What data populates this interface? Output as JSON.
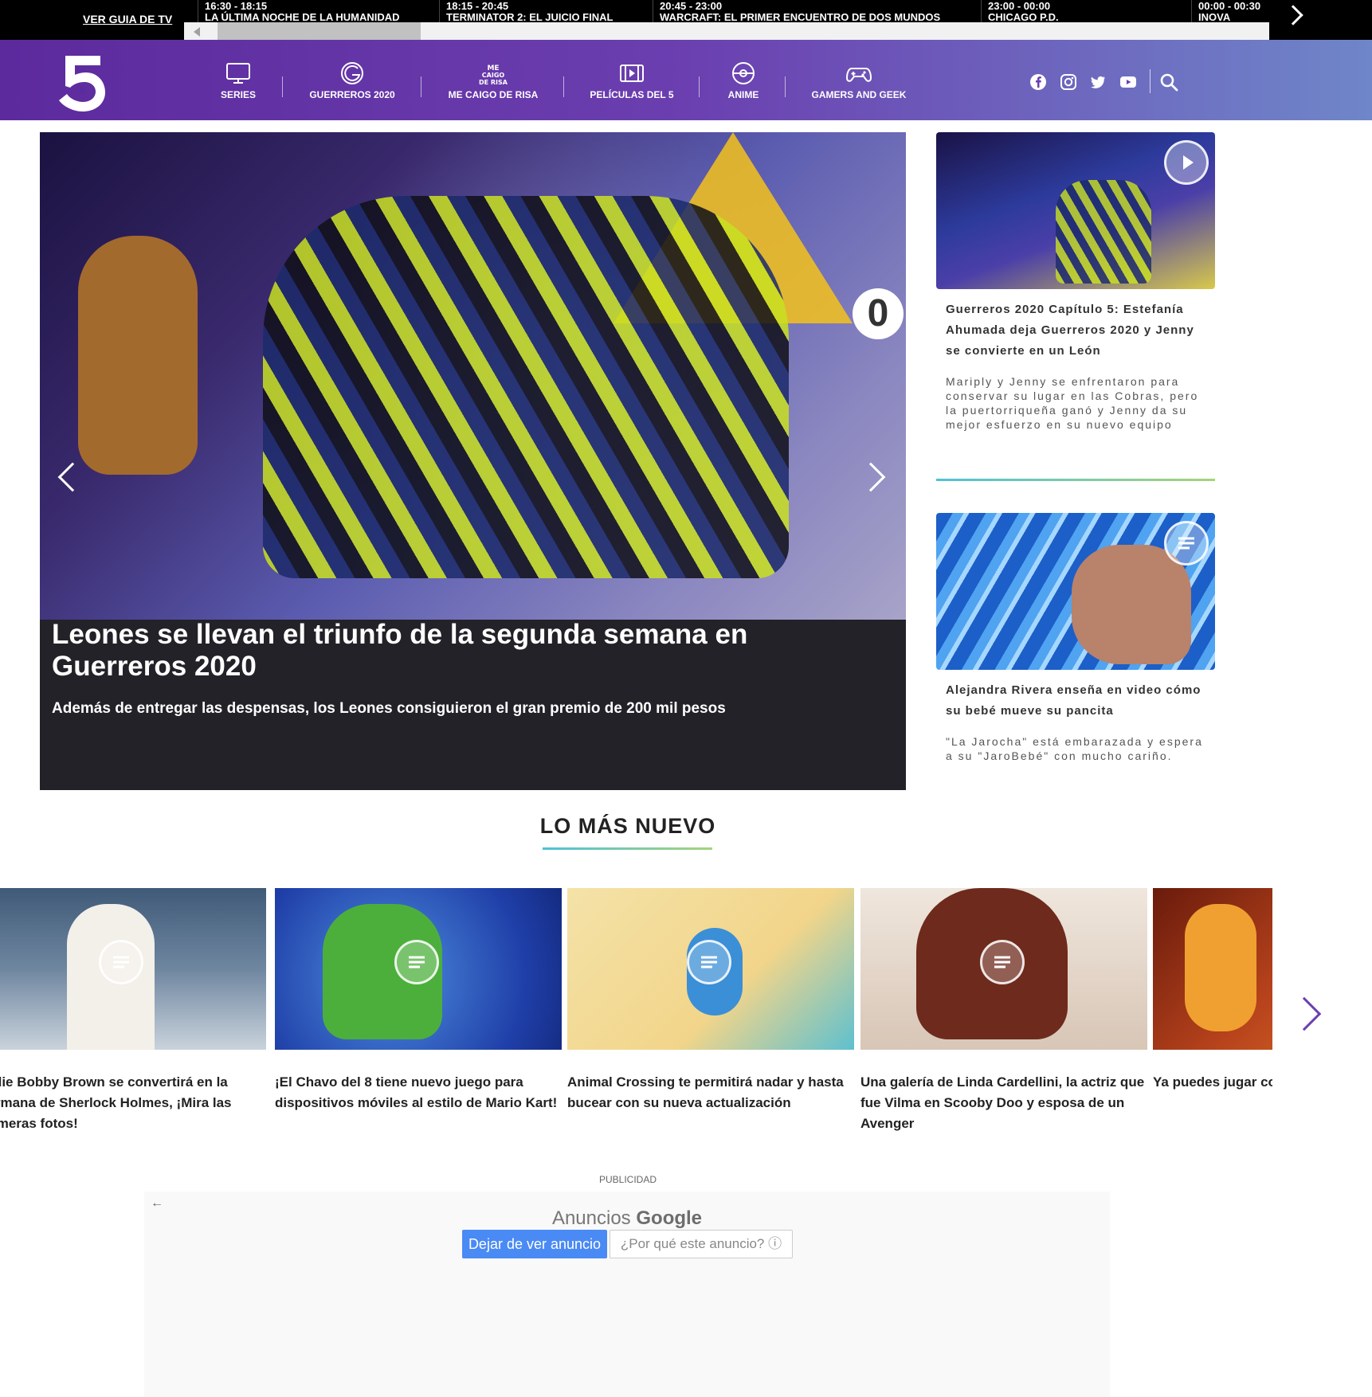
{
  "tvguide": {
    "link": "VER GUIA DE TV",
    "slots": [
      {
        "time": "16:30 - 18:15",
        "title": "LA ÚLTIMA NOCHE DE LA HUMANIDAD"
      },
      {
        "time": "18:15 - 20:45",
        "title": "TERMINATOR 2: EL JUICIO FINAL"
      },
      {
        "time": "20:45 - 23:00",
        "title": "WARCRAFT: EL PRIMER ENCUENTRO DE DOS MUNDOS"
      },
      {
        "time": "23:00 - 00:00",
        "title": "CHICAGO P.D."
      },
      {
        "time": "00:00 - 00:30",
        "title": "INOVA"
      }
    ]
  },
  "nav": {
    "items": [
      {
        "label": "SERIES",
        "icon": "tv-icon"
      },
      {
        "label": "GUERREROS 2020",
        "icon": "guerreros-icon"
      },
      {
        "label": "ME CAIGO DE RISA",
        "icon": "me-caigo-de-risa-icon"
      },
      {
        "label": "PELÍCULAS DEL 5",
        "icon": "film-icon"
      },
      {
        "label": "ANIME",
        "icon": "anime-icon"
      },
      {
        "label": "GAMERS AND GEEK",
        "icon": "gamepad-icon"
      }
    ],
    "social": [
      "facebook-icon",
      "instagram-icon",
      "twitter-icon",
      "youtube-icon"
    ],
    "search_icon": "search-icon"
  },
  "hero": {
    "title": "Leones se llevan el triunfo de la segunda semana en Guerreros 2020",
    "subtitle": "Además de entregar las despensas, los Leones consiguieron el gran premio de 200 mil pesos",
    "score_label": "0"
  },
  "side": [
    {
      "title": "Guerreros 2020 Capítulo 5: Estefanía Ahumada deja Guerreros 2020 y Jenny se convierte en un León",
      "desc": "Mariply y Jenny se enfrentaron para conservar su lugar en las Cobras, pero la puertorriqueña ganó y Jenny da su mejor esfuerzo en su nuevo equipo",
      "badge": "play-icon"
    },
    {
      "title": "Alejandra Rivera enseña en video cómo su bebé mueve su pancita",
      "desc": "\"La Jarocha\" está embarazada y espera a su \"JaroBebé\" con mucho cariño.",
      "badge": "article-icon"
    }
  ],
  "latest": {
    "heading": "LO MÁS NUEVO",
    "items": [
      {
        "title": "Millie Bobby Brown se convertirá en la hermana de Sherlock Holmes, ¡Mira las primeras fotos!"
      },
      {
        "title": "¡El Chavo del 8 tiene nuevo juego para dispositivos móviles al estilo de Mario Kart!"
      },
      {
        "title": "Animal Crossing te permitirá nadar y hasta bucear con su nueva actualización"
      },
      {
        "title": "Una galería de Linda Cardellini, la actriz que fue Vilma en Scooby Doo y esposa de un Avenger"
      },
      {
        "title": "Ya puedes jugar como Korra en este video"
      }
    ]
  },
  "ad": {
    "label": "PUBLICIDAD",
    "brand_prefix": "Anuncios",
    "brand": "Google",
    "stop_button": "Dejar de ver anuncio",
    "why_button": "¿Por qué este anuncio? ⓘ",
    "back": "←"
  },
  "colors": {
    "header_start": "#5c2a9d",
    "header_end": "#6f86c9",
    "accent_line_start": "#4fc1d6",
    "accent_line_end": "#a7d37a",
    "ad_button": "#4a8af4"
  }
}
